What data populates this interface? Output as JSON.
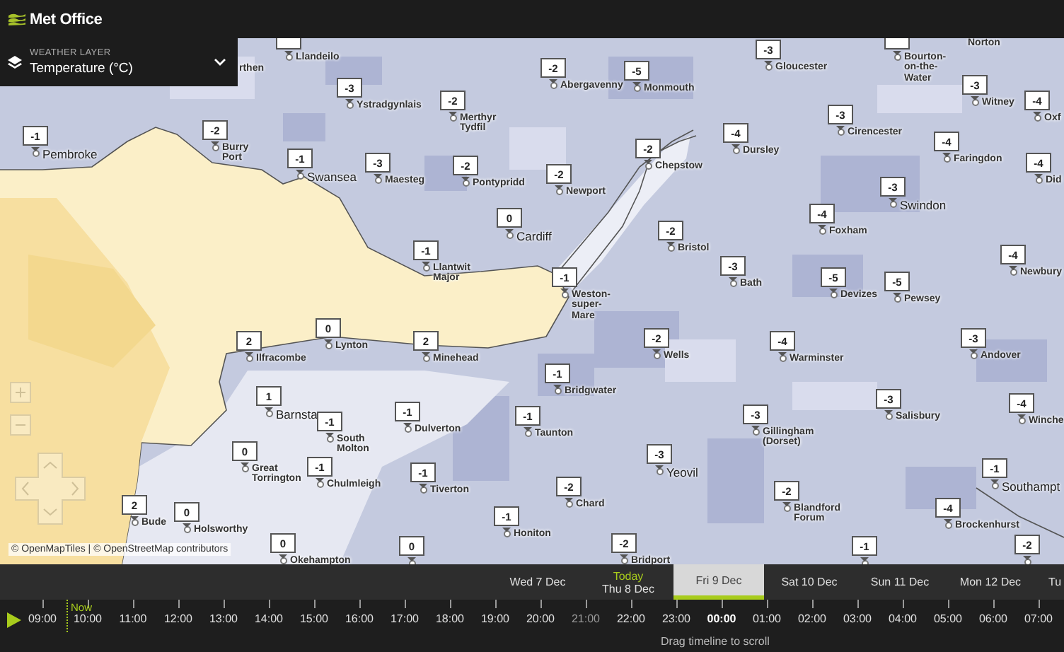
{
  "header": {
    "logo_text": "Met Office"
  },
  "layer_panel": {
    "caption": "WEATHER LAYER",
    "value": "Temperature (°C)"
  },
  "map": {
    "pins": [
      {
        "place": "Llandeilo",
        "kind": "town"
      },
      {
        "value": "-3",
        "place": "Gloucester",
        "kind": "town"
      },
      {
        "place": "Bourton-on-the-Water",
        "kind": "town"
      },
      {
        "value": "-3",
        "place": "Ystradgynlais",
        "kind": "town"
      },
      {
        "value": "-2",
        "place": "Abergavenny",
        "kind": "town"
      },
      {
        "value": "-5",
        "place": "Monmouth",
        "kind": "town"
      },
      {
        "value": "-3",
        "place": "Witney",
        "kind": "town"
      },
      {
        "value": "-2",
        "place": "Merthyr Tydfil",
        "kind": "town"
      },
      {
        "value": "-3",
        "place": "Cirencester",
        "kind": "town"
      },
      {
        "value": "-4",
        "place": "Oxf",
        "kind": "town"
      },
      {
        "value": "-1",
        "place": "Pembroke",
        "kind": "city"
      },
      {
        "value": "-2",
        "place": "Burry Port",
        "kind": "town"
      },
      {
        "value": "-2",
        "place": "Chepstow",
        "kind": "town"
      },
      {
        "value": "-4",
        "place": "Dursley",
        "kind": "town"
      },
      {
        "value": "-4",
        "place": "Faringdon",
        "kind": "town"
      },
      {
        "value": "-1",
        "place": "Swansea",
        "kind": "city"
      },
      {
        "value": "-3",
        "place": "Maesteg",
        "kind": "town"
      },
      {
        "value": "-2",
        "place": "Pontypridd",
        "kind": "town"
      },
      {
        "value": "-2",
        "place": "Newport",
        "kind": "town"
      },
      {
        "value": "-4",
        "place": "Did",
        "kind": "town"
      },
      {
        "value": "-3",
        "place": "Swindon",
        "kind": "city"
      },
      {
        "value": "0",
        "place": "Cardiff",
        "kind": "city"
      },
      {
        "value": "-2",
        "place": "Bristol",
        "kind": "town"
      },
      {
        "value": "-4",
        "place": "Foxham",
        "kind": "town"
      },
      {
        "value": "-1",
        "place": "Llantwit Major",
        "kind": "town"
      },
      {
        "value": "-3",
        "place": "Bath",
        "kind": "town"
      },
      {
        "value": "-4",
        "place": "Newbury",
        "kind": "town"
      },
      {
        "value": "-1",
        "place": "Weston-super-Mare",
        "kind": "town"
      },
      {
        "value": "-5",
        "place": "Devizes",
        "kind": "town"
      },
      {
        "value": "-5",
        "place": "Pewsey",
        "kind": "town"
      },
      {
        "value": "2",
        "place": "Ilfracombe",
        "kind": "town"
      },
      {
        "value": "0",
        "place": "Lynton",
        "kind": "town"
      },
      {
        "value": "2",
        "place": "Minehead",
        "kind": "town"
      },
      {
        "value": "-2",
        "place": "Wells",
        "kind": "town"
      },
      {
        "value": "-4",
        "place": "Warminster",
        "kind": "town"
      },
      {
        "value": "-3",
        "place": "Andover",
        "kind": "town"
      },
      {
        "value": "-1",
        "place": "Bridgwater",
        "kind": "town"
      },
      {
        "value": "1",
        "place": "Barnsta",
        "kind": "city"
      },
      {
        "value": "-1",
        "place": "Dulverton",
        "kind": "town"
      },
      {
        "value": "-1",
        "place": "Taunton",
        "kind": "town"
      },
      {
        "value": "-3",
        "place": "Gillingham (Dorset)",
        "kind": "town"
      },
      {
        "value": "-3",
        "place": "Salisbury",
        "kind": "town"
      },
      {
        "value": "-4",
        "place": "Winche",
        "kind": "town"
      },
      {
        "value": "-1",
        "place": "South Molton",
        "kind": "town"
      },
      {
        "value": "0",
        "place": "Great Torrington",
        "kind": "town"
      },
      {
        "value": "-1",
        "place": "Chulmleigh",
        "kind": "town"
      },
      {
        "value": "-1",
        "place": "Tiverton",
        "kind": "town"
      },
      {
        "value": "-3",
        "place": "Yeovil",
        "kind": "city"
      },
      {
        "value": "-1",
        "place": "Southampt",
        "kind": "city"
      },
      {
        "value": "2",
        "place": "Bude",
        "kind": "town"
      },
      {
        "value": "0",
        "place": "Holsworthy",
        "kind": "town"
      },
      {
        "value": "-1",
        "place": "Honiton",
        "kind": "town"
      },
      {
        "value": "-2",
        "place": "Chard",
        "kind": "town"
      },
      {
        "value": "-2",
        "place": "Blandford Forum",
        "kind": "town"
      },
      {
        "value": "-4",
        "place": "Brockenhurst",
        "kind": "town"
      },
      {
        "value": "0",
        "place": "Okehampton",
        "kind": "town"
      },
      {
        "value": "0"
      },
      {
        "value": "-2",
        "place": "Bridport",
        "kind": "town"
      },
      {
        "value": "-1"
      },
      {
        "value": "-2"
      }
    ],
    "labels": [
      "rthen",
      "Norton"
    ],
    "attribution": "© OpenMapTiles | © OpenStreetMap contributors"
  },
  "timeline": {
    "days": [
      {
        "label": "Wed 7 Dec",
        "selected": false
      },
      {
        "note": "Today",
        "label": "Thu 8 Dec",
        "selected": false
      },
      {
        "label": "Fri 9 Dec",
        "selected": true
      },
      {
        "label": "Sat 10 Dec",
        "selected": false
      },
      {
        "label": "Sun 11 Dec",
        "selected": false
      },
      {
        "label": "Mon 12 Dec",
        "selected": false
      },
      {
        "label": "Tu",
        "selected": false
      }
    ],
    "now_label": "Now",
    "hours": [
      {
        "label": "09:00",
        "selected": false,
        "dimmed": false
      },
      {
        "label": "10:00",
        "selected": false,
        "dimmed": false
      },
      {
        "label": "11:00",
        "selected": false,
        "dimmed": false
      },
      {
        "label": "12:00",
        "selected": false,
        "dimmed": false
      },
      {
        "label": "13:00",
        "selected": false,
        "dimmed": false
      },
      {
        "label": "14:00",
        "selected": false,
        "dimmed": false
      },
      {
        "label": "15:00",
        "selected": false,
        "dimmed": false
      },
      {
        "label": "16:00",
        "selected": false,
        "dimmed": false
      },
      {
        "label": "17:00",
        "selected": false,
        "dimmed": false
      },
      {
        "label": "18:00",
        "selected": false,
        "dimmed": false
      },
      {
        "label": "19:00",
        "selected": false,
        "dimmed": false
      },
      {
        "label": "20:00",
        "selected": false,
        "dimmed": false
      },
      {
        "label": "21:00",
        "selected": false,
        "dimmed": true
      },
      {
        "label": "22:00",
        "selected": false,
        "dimmed": false
      },
      {
        "label": "23:00",
        "selected": false,
        "dimmed": false
      },
      {
        "label": "00:00",
        "selected": true,
        "dimmed": false
      },
      {
        "label": "01:00",
        "selected": false,
        "dimmed": false
      },
      {
        "label": "02:00",
        "selected": false,
        "dimmed": false
      },
      {
        "label": "03:00",
        "selected": false,
        "dimmed": false
      },
      {
        "label": "04:00",
        "selected": false,
        "dimmed": false
      },
      {
        "label": "05:00",
        "selected": false,
        "dimmed": false
      },
      {
        "label": "06:00",
        "selected": false,
        "dimmed": false
      },
      {
        "label": "07:00",
        "selected": false,
        "dimmed": false
      }
    ],
    "hint": "Drag timeline to scroll"
  }
}
